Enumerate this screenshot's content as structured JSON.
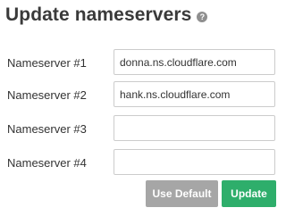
{
  "header": {
    "title": "Update nameservers",
    "help_icon": "?"
  },
  "form": {
    "fields": [
      {
        "label": "Nameserver #1",
        "value": "donna.ns.cloudflare.com"
      },
      {
        "label": "Nameserver #2",
        "value": "hank.ns.cloudflare.com"
      },
      {
        "label": "Nameserver #3",
        "value": ""
      },
      {
        "label": "Nameserver #4",
        "value": ""
      }
    ]
  },
  "actions": {
    "use_default_label": "Use Default",
    "update_label": "Update"
  },
  "colors": {
    "update_button": "#2eae6b",
    "default_button": "#a6a6a6"
  }
}
